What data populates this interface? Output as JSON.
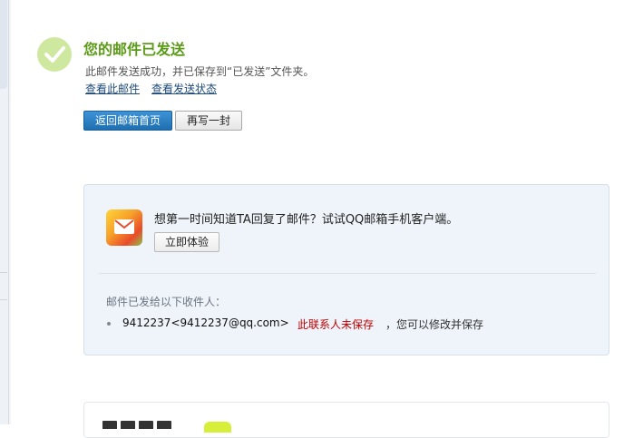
{
  "success": {
    "title": "您的邮件已发送",
    "description": "此邮件发送成功，并已保存到“已发送”文件夹。",
    "view_link": "查看此邮件",
    "status_link": "查看发送状态",
    "icon": "check-circle-icon",
    "accent_color": "#5b9b17"
  },
  "actions": {
    "back_button": "返回邮箱首页",
    "write_again_button": "再写一封"
  },
  "promo": {
    "icon": "qq-mail-app-icon",
    "text": "想第一时间知道TA回复了邮件？试试QQ邮箱手机客户端。",
    "try_button": "立即体验"
  },
  "recipients": {
    "label": "邮件已发给以下收件人：",
    "items": [
      {
        "address": "9412237<9412237@qq.com>",
        "status": "此联系人未保存",
        "hint": "，您可以修改并保存"
      }
    ],
    "status_color": "#c00000"
  }
}
